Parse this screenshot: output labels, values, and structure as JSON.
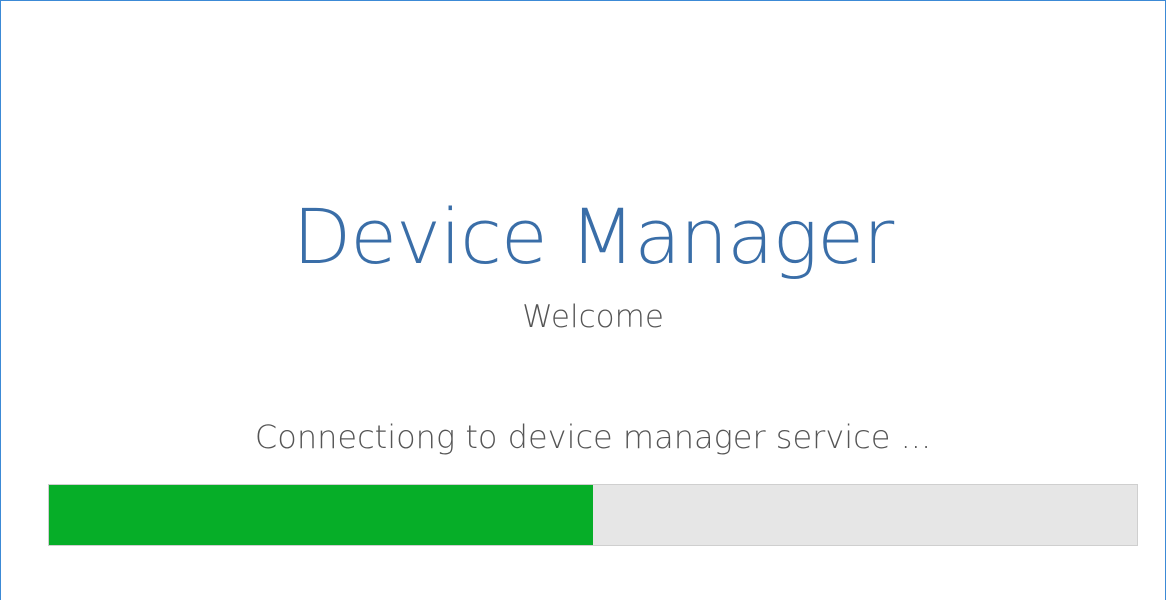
{
  "app": {
    "title": "Device Manager",
    "subtitle": "Welcome"
  },
  "loading": {
    "status_text": "Connectiong to device manager service ...",
    "progress_percent": 50
  },
  "colors": {
    "title": "#3a6ea8",
    "text": "#555555",
    "progress_fill": "#06ae28",
    "progress_track": "#e6e6e6",
    "window_border": "#3c8ad6"
  }
}
